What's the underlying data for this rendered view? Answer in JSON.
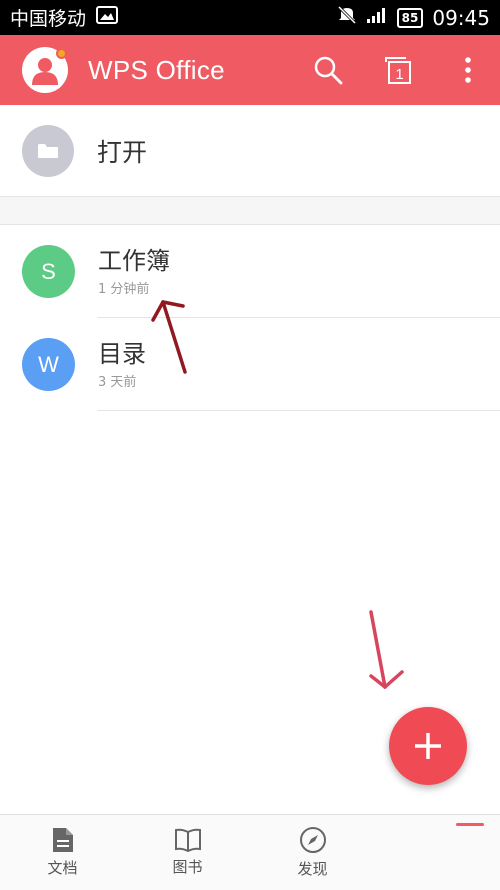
{
  "status_bar": {
    "carrier": "中国移动",
    "battery": "85",
    "time": "09:45"
  },
  "app_bar": {
    "title": "WPS Office",
    "tab_count": "1"
  },
  "open_row": {
    "label": "打开"
  },
  "files": [
    {
      "name": "工作簿",
      "time": "1 分钟前",
      "letter": "S",
      "color": "#5ccb86"
    },
    {
      "name": "目录",
      "time": "3 天前",
      "letter": "W",
      "color": "#5b9ff5"
    }
  ],
  "bottom_nav": [
    {
      "label": "文档",
      "icon": "document-icon"
    },
    {
      "label": "图书",
      "icon": "book-icon"
    },
    {
      "label": "发现",
      "icon": "compass-icon"
    }
  ],
  "colors": {
    "accent": "#f05b63",
    "fab": "#f04b55",
    "annotation_arrow": "#8f1a1f"
  }
}
